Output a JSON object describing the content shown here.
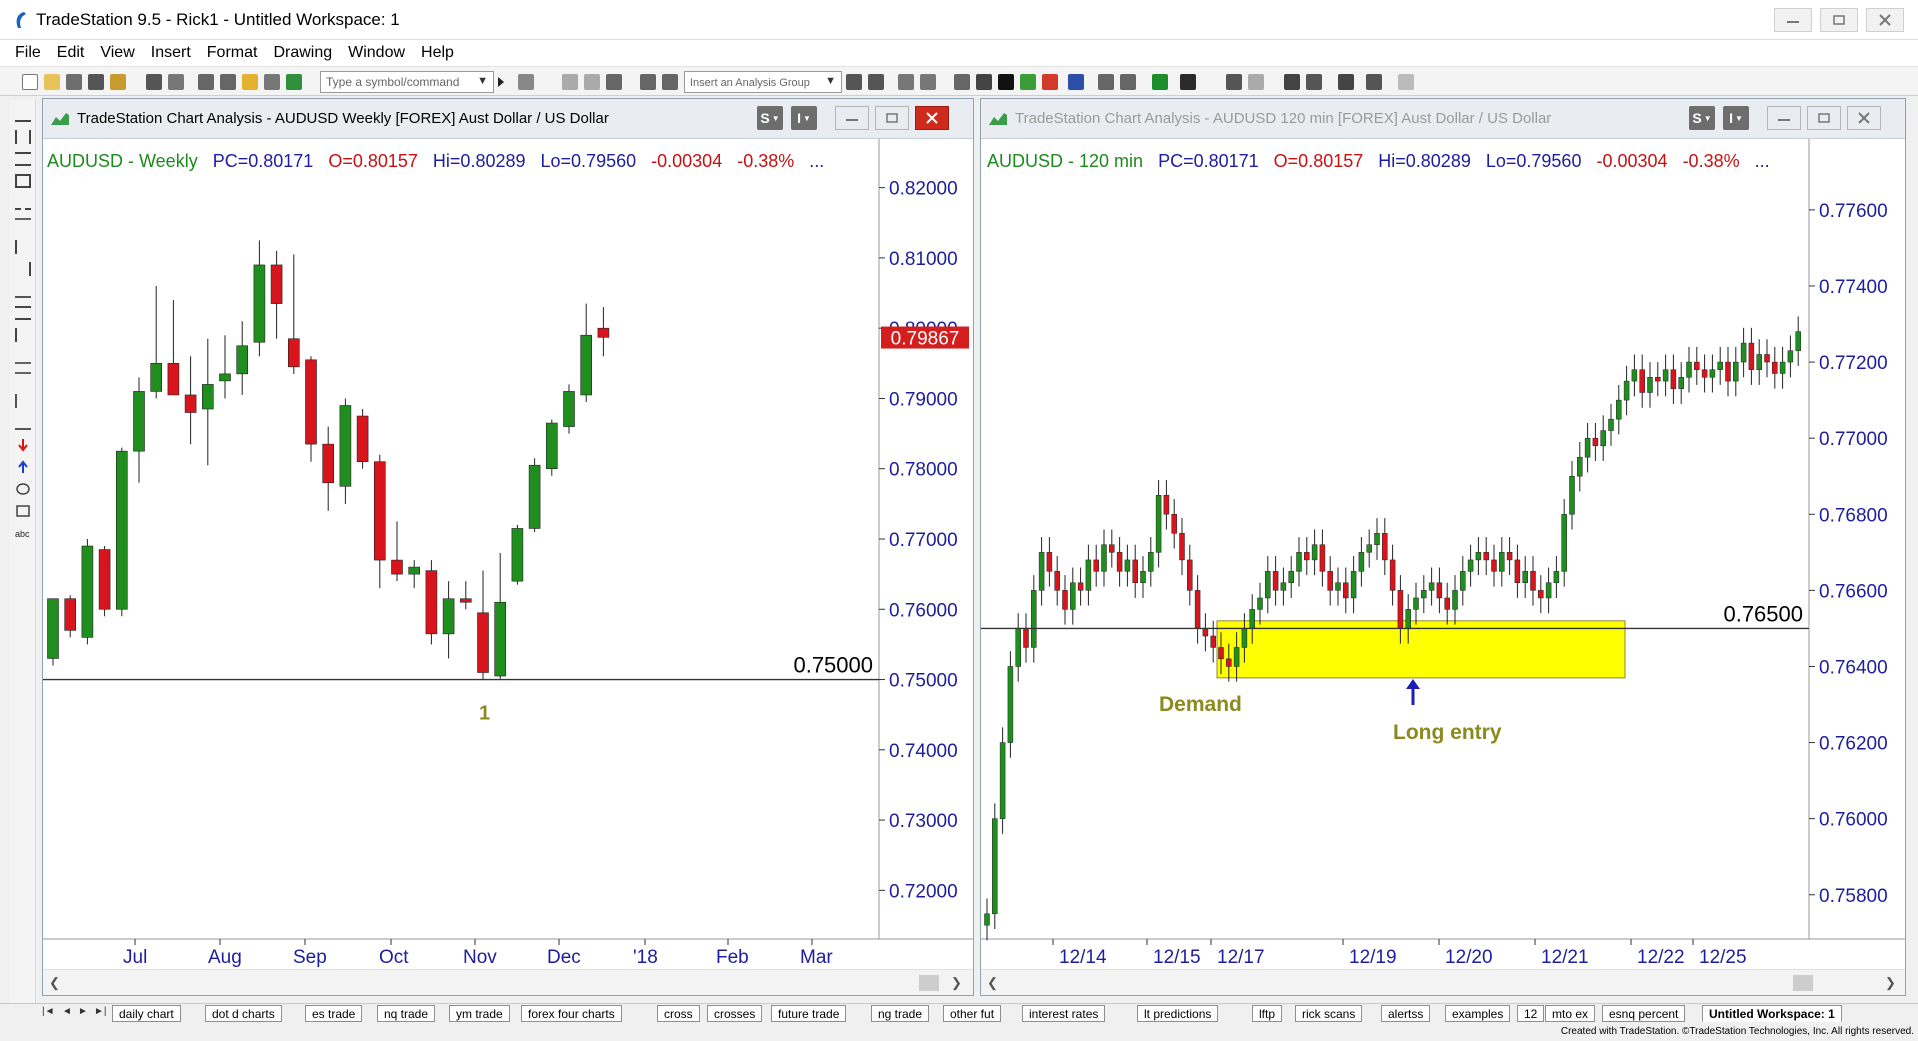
{
  "app": {
    "title": "TradeStation 9.5 - Rick1 - Untitled Workspace:  1",
    "menu": [
      "File",
      "Edit",
      "View",
      "Insert",
      "Format",
      "Drawing",
      "Window",
      "Help"
    ],
    "symbol_placeholder": "Type a symbol/command",
    "analysis_group_placeholder": "Insert an Analysis Group"
  },
  "left_chart": {
    "window_title": "TradeStation Chart Analysis - AUDUSD Weekly [FOREX] Aust Dollar / US Dollar",
    "header": {
      "symbol": "AUDUSD - Weekly",
      "pc": "PC=0.80171",
      "open": "O=0.80157",
      "high": "Hi=0.80289",
      "low": "Lo=0.79560",
      "change": "-0.00304",
      "pct": "-0.38%",
      "more": "..."
    },
    "last_price_label": "0.79867",
    "level_line_label": "0.75000",
    "annotation": "1",
    "colors": {
      "up": "#1f8e1f",
      "down": "#d8141c",
      "level_label_bg": "#d41e1e"
    }
  },
  "right_chart": {
    "window_title": "TradeStation Chart Analysis - AUDUSD 120 min [FOREX] Aust Dollar / US Dollar",
    "header": {
      "symbol": "AUDUSD - 120 min",
      "pc": "PC=0.80171",
      "open": "O=0.80157",
      "high": "Hi=0.80289",
      "low": "Lo=0.79560",
      "change": "-0.00304",
      "pct": "-0.38%",
      "more": "..."
    },
    "level_line_label": "0.76500",
    "demand_label": "Demand",
    "entry_label": "Long entry",
    "colors": {
      "zone": "#ffff00",
      "annotation_text": "#8a8a1f",
      "arrow": "#1d1db4"
    }
  },
  "chart_data": [
    {
      "type": "candlestick",
      "title": "AUDUSD - Weekly",
      "x_labels": [
        "Jul",
        "Aug",
        "Sep",
        "Oct",
        "Nov",
        "Dec",
        "'18",
        "Feb",
        "Mar"
      ],
      "y_ticks": [
        "0.82000",
        "0.81000",
        "0.80000",
        "0.79000",
        "0.78000",
        "0.77000",
        "0.76000",
        "0.75000",
        "0.74000",
        "0.73000",
        "0.72000"
      ],
      "ylim": [
        0.7145,
        0.8255
      ],
      "horizontal_line": 0.75,
      "last_price": 0.79867,
      "candles": [
        {
          "o": 0.753,
          "h": 0.761,
          "l": 0.752,
          "c": 0.7615
        },
        {
          "o": 0.7615,
          "h": 0.762,
          "l": 0.756,
          "c": 0.757
        },
        {
          "o": 0.756,
          "h": 0.77,
          "l": 0.755,
          "c": 0.769
        },
        {
          "o": 0.7685,
          "h": 0.769,
          "l": 0.759,
          "c": 0.76
        },
        {
          "o": 0.76,
          "h": 0.783,
          "l": 0.759,
          "c": 0.7825
        },
        {
          "o": 0.7825,
          "h": 0.793,
          "l": 0.778,
          "c": 0.791
        },
        {
          "o": 0.791,
          "h": 0.806,
          "l": 0.79,
          "c": 0.795
        },
        {
          "o": 0.795,
          "h": 0.804,
          "l": 0.791,
          "c": 0.7905
        },
        {
          "o": 0.7905,
          "h": 0.796,
          "l": 0.7835,
          "c": 0.788
        },
        {
          "o": 0.7885,
          "h": 0.7985,
          "l": 0.7805,
          "c": 0.792
        },
        {
          "o": 0.7925,
          "h": 0.799,
          "l": 0.79,
          "c": 0.7935
        },
        {
          "o": 0.7935,
          "h": 0.801,
          "l": 0.7905,
          "c": 0.7975
        },
        {
          "o": 0.798,
          "h": 0.8125,
          "l": 0.796,
          "c": 0.809
        },
        {
          "o": 0.809,
          "h": 0.811,
          "l": 0.7985,
          "c": 0.8035
        },
        {
          "o": 0.7985,
          "h": 0.8105,
          "l": 0.7935,
          "c": 0.7945
        },
        {
          "o": 0.7955,
          "h": 0.796,
          "l": 0.781,
          "c": 0.7835
        },
        {
          "o": 0.7835,
          "h": 0.786,
          "l": 0.774,
          "c": 0.778
        },
        {
          "o": 0.7775,
          "h": 0.79,
          "l": 0.775,
          "c": 0.789
        },
        {
          "o": 0.7875,
          "h": 0.7885,
          "l": 0.78,
          "c": 0.781
        },
        {
          "o": 0.781,
          "h": 0.782,
          "l": 0.763,
          "c": 0.767
        },
        {
          "o": 0.767,
          "h": 0.7725,
          "l": 0.764,
          "c": 0.765
        },
        {
          "o": 0.765,
          "h": 0.767,
          "l": 0.763,
          "c": 0.766
        },
        {
          "o": 0.7655,
          "h": 0.767,
          "l": 0.755,
          "c": 0.7565
        },
        {
          "o": 0.7565,
          "h": 0.764,
          "l": 0.753,
          "c": 0.7615
        },
        {
          "o": 0.7615,
          "h": 0.764,
          "l": 0.76,
          "c": 0.761
        },
        {
          "o": 0.7595,
          "h": 0.7655,
          "l": 0.75,
          "c": 0.751
        },
        {
          "o": 0.7505,
          "h": 0.768,
          "l": 0.75,
          "c": 0.761
        },
        {
          "o": 0.764,
          "h": 0.772,
          "l": 0.7635,
          "c": 0.7715
        },
        {
          "o": 0.7715,
          "h": 0.7815,
          "l": 0.771,
          "c": 0.7805
        },
        {
          "o": 0.78,
          "h": 0.787,
          "l": 0.779,
          "c": 0.7865
        },
        {
          "o": 0.786,
          "h": 0.792,
          "l": 0.785,
          "c": 0.791
        },
        {
          "o": 0.7905,
          "h": 0.8035,
          "l": 0.7895,
          "c": 0.799
        },
        {
          "o": 0.8,
          "h": 0.803,
          "l": 0.796,
          "c": 0.7987
        }
      ]
    },
    {
      "type": "candlestick",
      "title": "AUDUSD - 120 min",
      "x_labels": [
        "12/14",
        "12/15",
        "12/17",
        "12/19",
        "12/20",
        "12/21",
        "12/22",
        "12/25"
      ],
      "y_ticks": [
        "0.77600",
        "0.77400",
        "0.77200",
        "0.77000",
        "0.76800",
        "0.76600",
        "0.76400",
        "0.76200",
        "0.76000",
        "0.75800"
      ],
      "ylim": [
        0.7571,
        0.7776
      ],
      "horizontal_line": 0.765,
      "demand_zone": {
        "from": 0.7637,
        "to": 0.7652
      },
      "closes": [
        0.7575,
        0.76,
        0.762,
        0.764,
        0.765,
        0.7645,
        0.766,
        0.767,
        0.7665,
        0.766,
        0.7655,
        0.7662,
        0.766,
        0.7668,
        0.7665,
        0.7672,
        0.767,
        0.7665,
        0.7668,
        0.7662,
        0.7665,
        0.767,
        0.7685,
        0.768,
        0.7675,
        0.7668,
        0.766,
        0.765,
        0.7648,
        0.7645,
        0.7642,
        0.764,
        0.7645,
        0.765,
        0.7655,
        0.7658,
        0.7665,
        0.766,
        0.7662,
        0.7665,
        0.767,
        0.7668,
        0.7672,
        0.7665,
        0.766,
        0.7662,
        0.7658,
        0.7665,
        0.767,
        0.7672,
        0.7675,
        0.7668,
        0.766,
        0.765,
        0.7655,
        0.7658,
        0.766,
        0.7662,
        0.7658,
        0.7655,
        0.766,
        0.7665,
        0.7668,
        0.767,
        0.7668,
        0.7665,
        0.767,
        0.7668,
        0.7662,
        0.7665,
        0.766,
        0.7658,
        0.7662,
        0.7665,
        0.768,
        0.769,
        0.7695,
        0.77,
        0.7698,
        0.7702,
        0.7705,
        0.771,
        0.7715,
        0.7718,
        0.7712,
        0.7716,
        0.7715,
        0.7718,
        0.7713,
        0.7716,
        0.772,
        0.7718,
        0.7716,
        0.7718,
        0.772,
        0.7715,
        0.772,
        0.7725,
        0.7718,
        0.7722,
        0.772,
        0.7717,
        0.772,
        0.7723,
        0.7728
      ]
    }
  ],
  "tabs": [
    "daily chart",
    "dot d charts",
    "es trade",
    "nq trade",
    "ym trade",
    "forex four charts",
    "cross",
    "crosses",
    "future trade",
    "ng trade",
    "other fut",
    "interest rates",
    "lt predictions",
    "lftp",
    "rick scans",
    "alertss",
    "examples",
    "12",
    "mto ex",
    "esnq percent",
    "Untitled Workspace: 1"
  ],
  "status": {
    "credit": "Created with TradeStation. ©TradeStation Technologies, Inc. All rights reserved."
  }
}
